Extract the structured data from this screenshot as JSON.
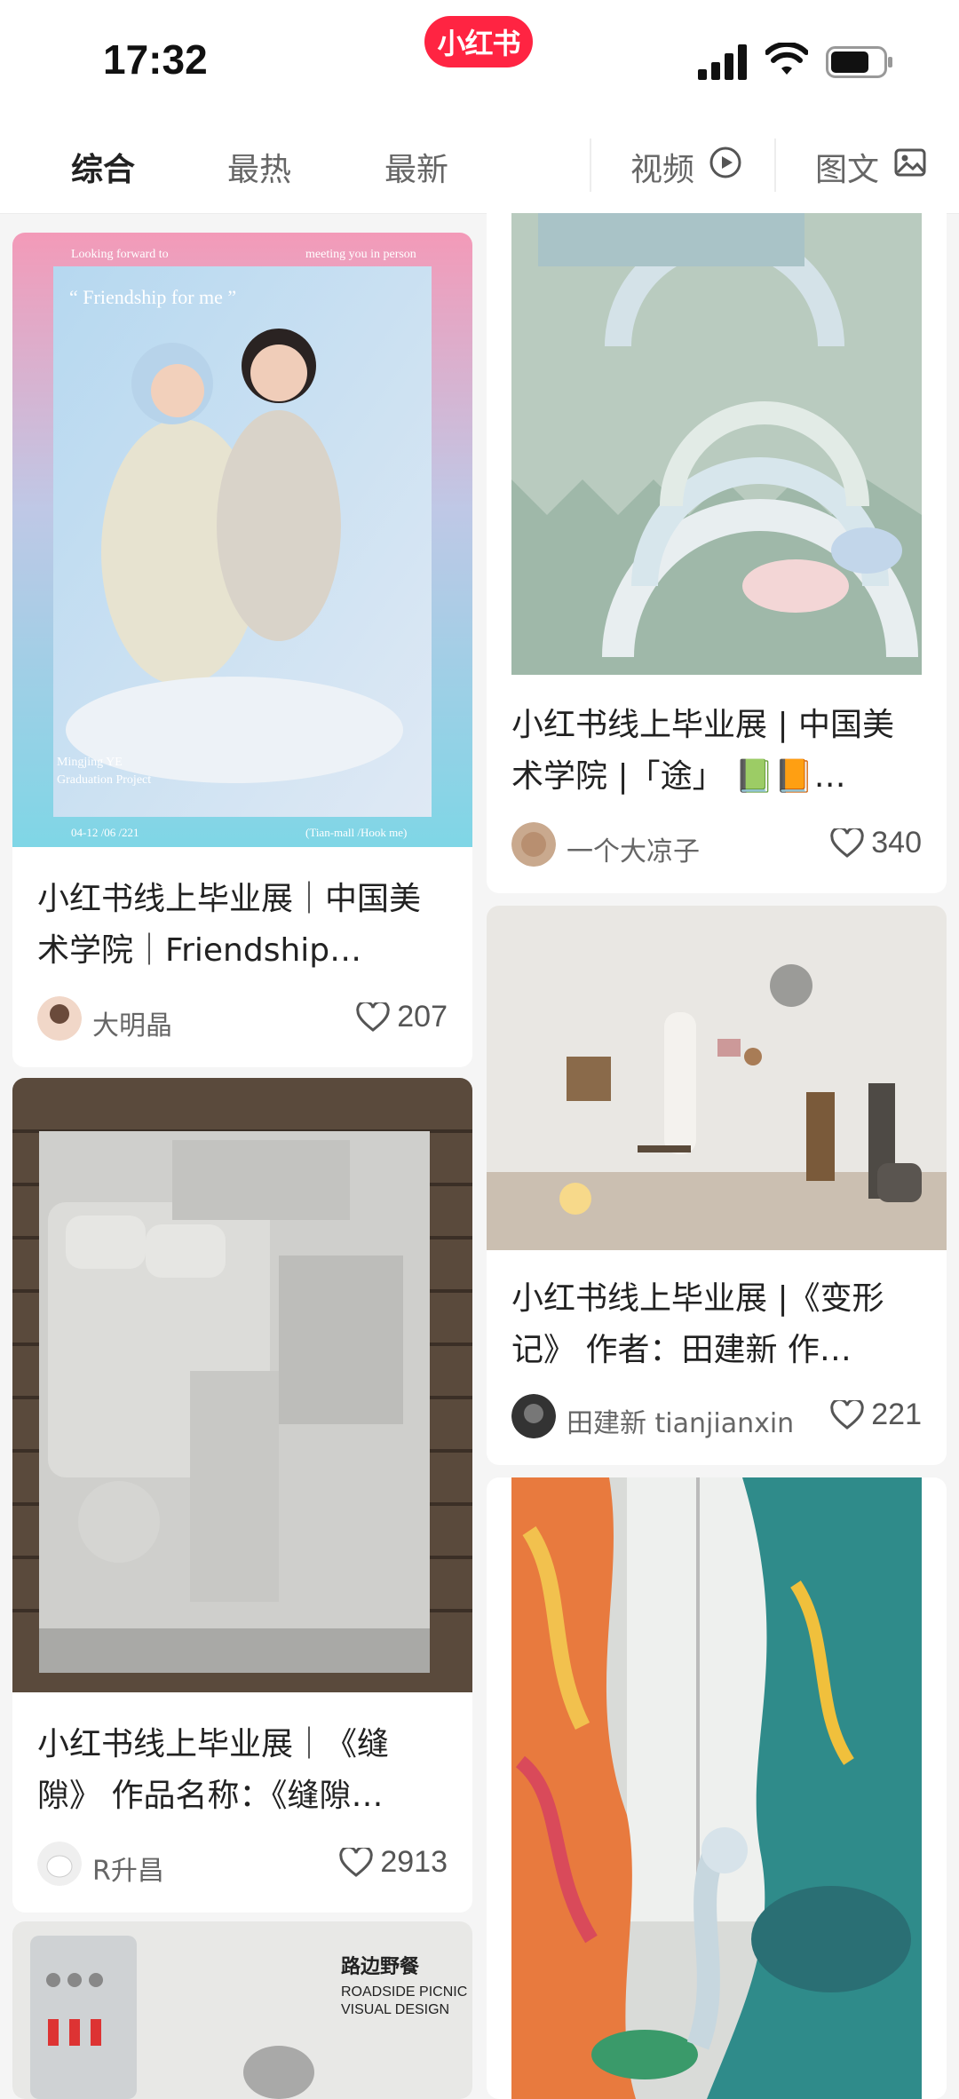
{
  "status_bar": {
    "time": "17:32",
    "logo_text": "小红书"
  },
  "tabs": {
    "items": [
      {
        "label": "综合",
        "active": true
      },
      {
        "label": "最热",
        "active": false
      },
      {
        "label": "最新",
        "active": false
      }
    ],
    "video_label": "视频",
    "image_label": "图文"
  },
  "cards": [
    {
      "title": "小红书线上毕业展｜中国美术学院｜Friendship…",
      "author": "大明晶",
      "likes": "207",
      "cover_texts": {
        "top_left": "Looking forward to",
        "top_right": "meeting you in person",
        "center": "“ Friendship for me ”",
        "bottom_name": "Mingjing YE",
        "bottom_proj": "Graduation Project",
        "bottom_date": "04-12 /06 /221",
        "bottom_right": "(Tian-mall /Hook me)"
      }
    },
    {
      "title": "小红书线上毕业展 | 中国美术学院 |「途」 📗📙…",
      "author": "一个大凉子",
      "likes": "340"
    },
    {
      "title": "小红书线上毕业展｜《缝隙》 作品名称：《缝隙…",
      "author": "R升昌",
      "likes": "2913"
    },
    {
      "title": "小红书线上毕业展 |《变形记》 作者：田建新 作…",
      "author": "田建新 tianjianxin",
      "likes": "221"
    },
    {
      "cover_texts": {
        "heading": "路边野餐",
        "sub1": "ROADSIDE PICNIC",
        "sub2": "VISUAL DESIGN"
      }
    }
  ]
}
